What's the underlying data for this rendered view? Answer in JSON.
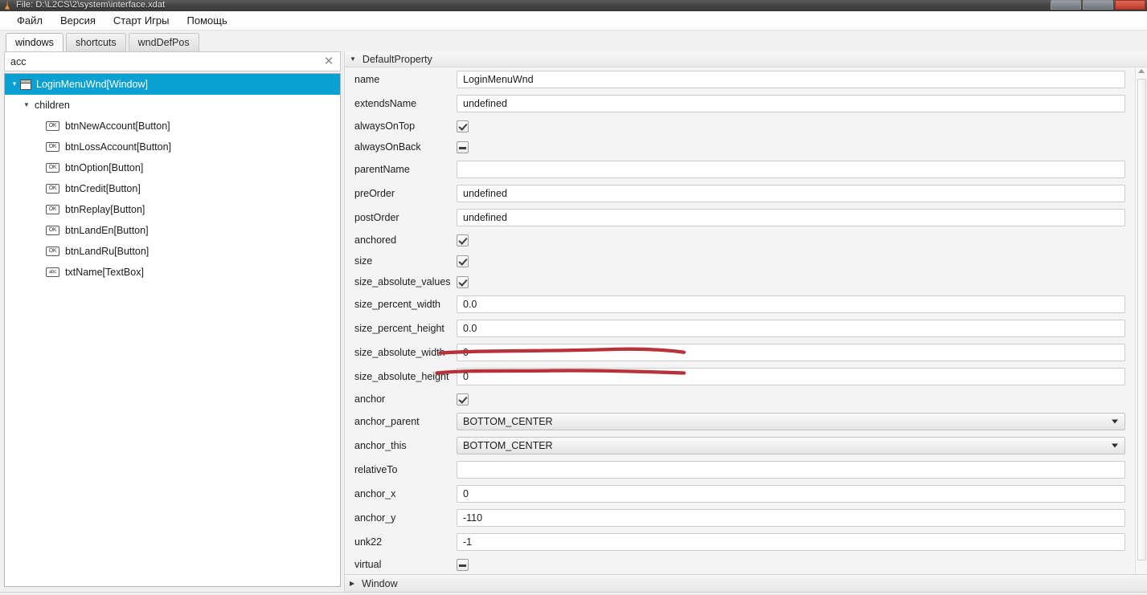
{
  "window": {
    "title": "File: D:\\L2CS\\2\\system\\interface.xdat",
    "icon": "app-icon",
    "controls": [
      "minimize",
      "maximize",
      "close"
    ]
  },
  "menubar": {
    "items": [
      {
        "label": "Файл",
        "name": "menu-file"
      },
      {
        "label": "Версия",
        "name": "menu-version"
      },
      {
        "label": "Старт Игры",
        "name": "menu-start-game"
      },
      {
        "label": "Помощь",
        "name": "menu-help"
      }
    ]
  },
  "tabs": {
    "items": [
      {
        "label": "windows",
        "active": true
      },
      {
        "label": "shortcuts",
        "active": false
      },
      {
        "label": "wndDefPos",
        "active": false
      }
    ]
  },
  "search": {
    "value": "acc",
    "placeholder": "",
    "clear_icon": "close-icon"
  },
  "tree": {
    "root": {
      "label": "LoginMenuWnd[Window]",
      "icon": "window-icon",
      "selected": true,
      "expanded": true
    },
    "children_node": {
      "label": "children",
      "expanded": true
    },
    "items": [
      {
        "label": "btnNewAccount[Button]",
        "icon": "OK"
      },
      {
        "label": "btnLossAccount[Button]",
        "icon": "OK"
      },
      {
        "label": "btnOption[Button]",
        "icon": "OK"
      },
      {
        "label": "btnCredit[Button]",
        "icon": "OK"
      },
      {
        "label": "btnReplay[Button]",
        "icon": "OK"
      },
      {
        "label": "btnLandEn[Button]",
        "icon": "OK"
      },
      {
        "label": "btnLandRu[Button]",
        "icon": "OK"
      },
      {
        "label": "txtName[TextBox]",
        "icon": "abc"
      }
    ]
  },
  "properties": {
    "group_title": "DefaultProperty",
    "group_expanded": true,
    "rows": [
      {
        "label": "name",
        "type": "text",
        "value": "LoginMenuWnd"
      },
      {
        "label": "extendsName",
        "type": "text",
        "value": "undefined"
      },
      {
        "label": "alwaysOnTop",
        "type": "checkbox",
        "state": "checked"
      },
      {
        "label": "alwaysOnBack",
        "type": "checkbox",
        "state": "indeterminate"
      },
      {
        "label": "parentName",
        "type": "text",
        "value": ""
      },
      {
        "label": "preOrder",
        "type": "text",
        "value": "undefined"
      },
      {
        "label": "postOrder",
        "type": "text",
        "value": "undefined"
      },
      {
        "label": "anchored",
        "type": "checkbox",
        "state": "checked"
      },
      {
        "label": "size",
        "type": "checkbox",
        "state": "checked"
      },
      {
        "label": "size_absolute_values",
        "type": "checkbox",
        "state": "checked"
      },
      {
        "label": "size_percent_width",
        "type": "text",
        "value": "0.0"
      },
      {
        "label": "size_percent_height",
        "type": "text",
        "value": "0.0"
      },
      {
        "label": "size_absolute_width",
        "type": "text",
        "value": "0",
        "annotated": true
      },
      {
        "label": "size_absolute_height",
        "type": "text",
        "value": "0",
        "annotated": true
      },
      {
        "label": "anchor",
        "type": "checkbox",
        "state": "checked"
      },
      {
        "label": "anchor_parent",
        "type": "select",
        "value": "BOTTOM_CENTER"
      },
      {
        "label": "anchor_this",
        "type": "select",
        "value": "BOTTOM_CENTER"
      },
      {
        "label": "relativeTo",
        "type": "text",
        "value": ""
      },
      {
        "label": "anchor_x",
        "type": "text",
        "value": "0"
      },
      {
        "label": "anchor_y",
        "type": "text",
        "value": "-110"
      },
      {
        "label": "unk22",
        "type": "text",
        "value": "-1"
      },
      {
        "label": "virtual",
        "type": "checkbox",
        "state": "indeterminate"
      },
      {
        "label": "",
        "type": "text",
        "value": ""
      }
    ]
  },
  "bottom_group": {
    "title": "Window",
    "expanded": false
  },
  "colors": {
    "selection": "#0aa0d2",
    "annotation": "#b7323a",
    "titlebar": "#454545",
    "close_button": "#c3392a"
  },
  "glyphs": {
    "triangle_down": "▼",
    "triangle_right": "▶",
    "clear": "✕"
  }
}
